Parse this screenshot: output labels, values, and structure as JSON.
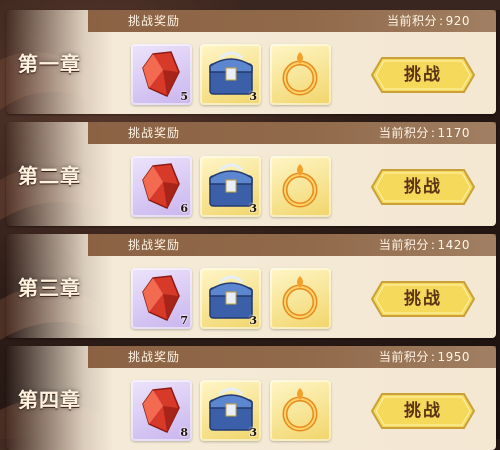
{
  "header_label": "挑战奖励",
  "score_label": "当前积分",
  "score_sep": ":",
  "button_label": "挑战",
  "chapters": [
    {
      "title": "第一章",
      "score": "920",
      "items": [
        {
          "count": "5"
        },
        {
          "count": "3"
        },
        {
          "count": ""
        }
      ]
    },
    {
      "title": "第二章",
      "score": "1170",
      "items": [
        {
          "count": "6"
        },
        {
          "count": "3"
        },
        {
          "count": ""
        }
      ]
    },
    {
      "title": "第三章",
      "score": "1420",
      "items": [
        {
          "count": "7"
        },
        {
          "count": "3"
        },
        {
          "count": ""
        }
      ]
    },
    {
      "title": "第四章",
      "score": "1950",
      "items": [
        {
          "count": "8"
        },
        {
          "count": "3"
        },
        {
          "count": ""
        }
      ]
    }
  ],
  "icons": {
    "item1": "red-crystal-icon",
    "item2": "treasure-chest-icon",
    "item3": "golden-ring-icon"
  },
  "colors": {
    "button": "#f5d95a",
    "header": "#865c3c",
    "panel": "#f4e8d3"
  }
}
